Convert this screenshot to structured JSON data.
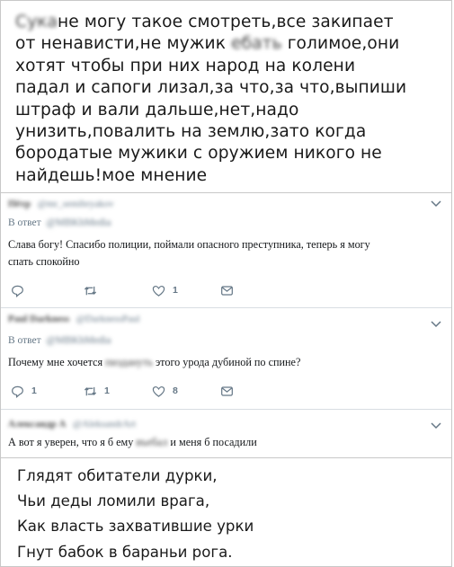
{
  "top_comment": {
    "redacted_start": "Сука",
    "lines": [
      "не могу такое смотреть,все закипает",
      "от ненависти,не мужик",
      "хотят чтобы при них народ на колени",
      "падал и сапоги лизал,за что,за что,выпиши",
      "штраф и вали дальше,нет,надо",
      "унизить,повалить на землю,зато когда",
      "бородатые мужики с оружием никого не",
      "найдешь!мое мнение"
    ],
    "redacted_mid": "ебать",
    "line2_tail": "голимое,они"
  },
  "tweets": [
    {
      "name": "Пётр",
      "handle": "@mr_semibryakov",
      "reply_prefix": "В ответ",
      "reply_to": "@MBKhMedia",
      "body_lines": [
        "Слава богу! Спасибо полиции, поймали опасного преступника, теперь я могу",
        "спать спокойно"
      ],
      "actions": {
        "reply": "",
        "retweet": "",
        "like": "1"
      }
    },
    {
      "name": "Paul Darkness",
      "handle": "@DarknessPaul",
      "reply_prefix": "В ответ",
      "reply_to": "@MBKhMedia",
      "body_pre": "Почему мне хочется",
      "body_redacted": "пиздануть",
      "body_post": "этого урода дубиной по спине?",
      "actions": {
        "reply": "1",
        "retweet": "1",
        "like": "8"
      }
    },
    {
      "name": "Александр А",
      "handle": "@AleksandrArt",
      "body_pre": "А вот я уверен, что я б ему",
      "body_redacted": "въебал",
      "body_post": "и меня б посадили"
    }
  ],
  "poem": {
    "lines": [
      "Глядят обитатели дурки,",
      "Чьи деды ломили врага,",
      "Как власть захватившие урки",
      "Гнут бабок в бараньи рога."
    ]
  },
  "icons": {
    "reply": "reply-icon",
    "retweet": "retweet-icon",
    "like": "heart-icon",
    "dm": "message-icon",
    "menu": "chevron-down-icon"
  },
  "colors": {
    "muted": "#657786",
    "text": "#14171a",
    "border": "#c8c8c8"
  }
}
